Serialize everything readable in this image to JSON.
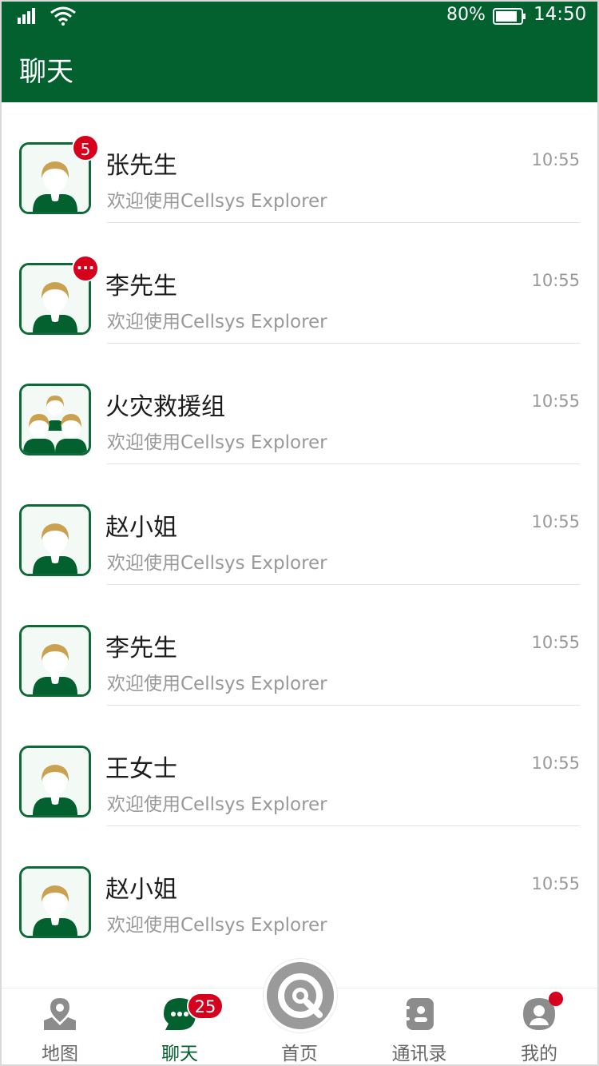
{
  "status_bar": {
    "battery_percent": "80%",
    "time": "14:50"
  },
  "header": {
    "title": "聊天"
  },
  "chats": [
    {
      "name": "张先生",
      "preview": "欢迎使用Cellsys Explorer",
      "time": "10:55",
      "badge": "5",
      "avatar": "single-person-avatar-icon"
    },
    {
      "name": "李先生",
      "preview": "欢迎使用Cellsys Explorer",
      "time": "10:55",
      "badge": "···",
      "avatar": "single-person-avatar-icon"
    },
    {
      "name": "火灾救援组",
      "preview": "欢迎使用Cellsys Explorer",
      "time": "10:55",
      "badge": "",
      "avatar": "group-avatar-icon"
    },
    {
      "name": "赵小姐",
      "preview": "欢迎使用Cellsys Explorer",
      "time": "10:55",
      "badge": "",
      "avatar": "single-person-avatar-icon"
    },
    {
      "name": "李先生",
      "preview": "欢迎使用Cellsys Explorer",
      "time": "10:55",
      "badge": "",
      "avatar": "single-person-avatar-icon"
    },
    {
      "name": "王女士",
      "preview": "欢迎使用Cellsys Explorer",
      "time": "10:55",
      "badge": "",
      "avatar": "single-person-avatar-icon"
    },
    {
      "name": "赵小姐",
      "preview": "欢迎使用Cellsys Explorer",
      "time": "10:55",
      "badge": "",
      "avatar": "single-person-avatar-icon"
    }
  ],
  "tabbar": {
    "tabs": [
      {
        "label": "地图",
        "icon": "map-pin-icon"
      },
      {
        "label": "聊天",
        "icon": "chat-bubble-icon",
        "active": true
      },
      {
        "label": "首页",
        "icon": "home-target-icon"
      },
      {
        "label": "通讯录",
        "icon": "contacts-icon"
      },
      {
        "label": "我的",
        "icon": "profile-icon"
      }
    ],
    "chat_badge": "25"
  },
  "colors": {
    "brand_green": "#03612f",
    "badge_red": "#d6001c",
    "text_primary": "#1c1c1c",
    "text_secondary": "#999999"
  }
}
